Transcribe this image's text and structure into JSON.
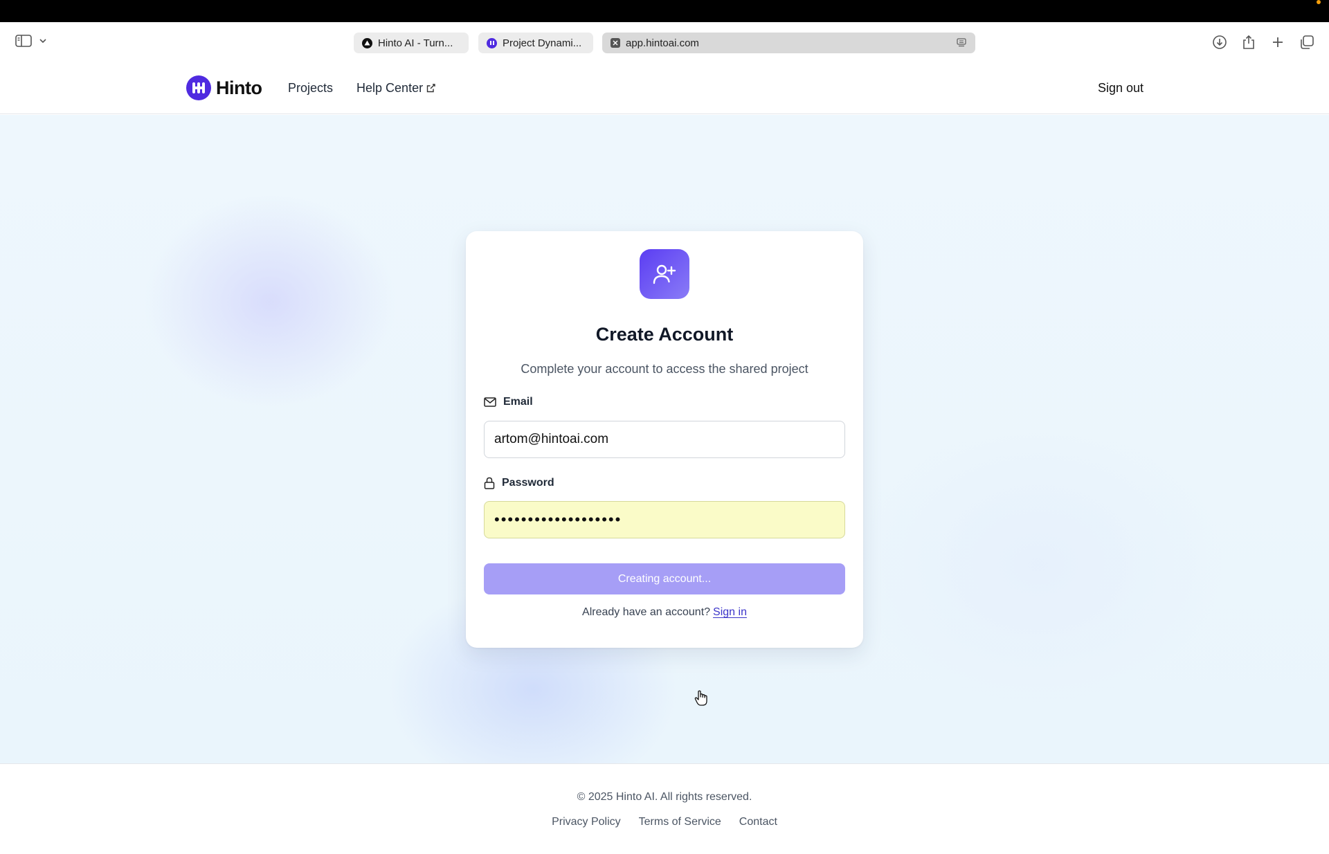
{
  "browser": {
    "tabs": [
      {
        "label": "Hinto AI - Turn...",
        "icon": "triangle-logo-icon"
      },
      {
        "label": "Project Dynami...",
        "icon": "hinto-logo-icon"
      },
      {
        "label": "app.hintoai.com",
        "icon": "close-tab-icon"
      }
    ]
  },
  "header": {
    "logo_text": "Hinto",
    "nav": {
      "projects": "Projects",
      "help_center": "Help Center"
    },
    "sign_out": "Sign out"
  },
  "card": {
    "icon": "user-plus-icon",
    "title": "Create Account",
    "subtitle": "Complete your account to access the shared project",
    "email_label": "Email",
    "email_value": "artom@hintoai.com",
    "password_label": "Password",
    "password_value": "•••••••••••••••••••",
    "submit_label": "Creating account...",
    "signin_prompt": "Already have an account?",
    "signin_link": "Sign in"
  },
  "footer": {
    "copyright": "© 2025 Hinto AI. All rights reserved.",
    "links": {
      "privacy": "Privacy Policy",
      "terms": "Terms of Service",
      "contact": "Contact"
    }
  },
  "colors": {
    "brand": "#4f2be0",
    "button": "#a69ef6",
    "autofill": "#fafbc8"
  }
}
